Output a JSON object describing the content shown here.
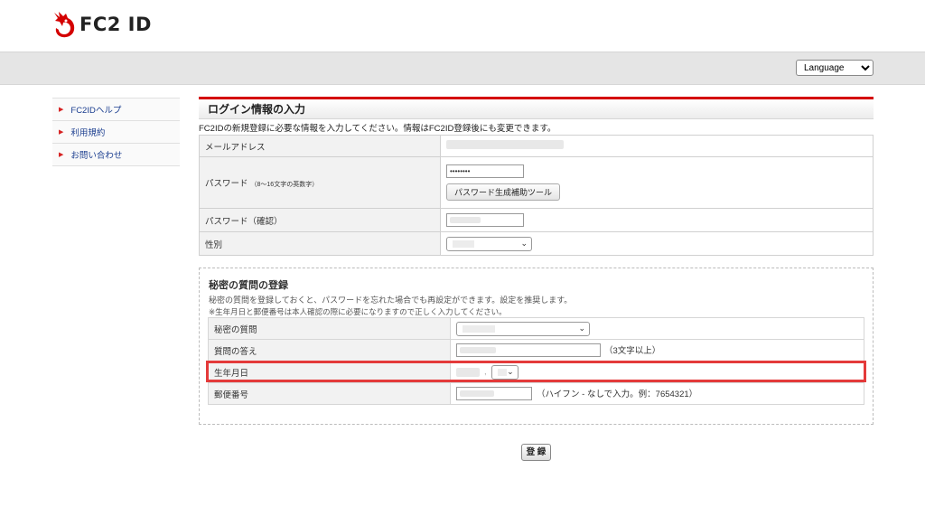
{
  "brand": {
    "name": "FC2 ID",
    "accent": "#d40000"
  },
  "topbar": {
    "language_label": "Language"
  },
  "sidebar": {
    "items": [
      {
        "label": "FC2IDヘルプ"
      },
      {
        "label": "利用規約"
      },
      {
        "label": "お問い合わせ"
      }
    ]
  },
  "login_section": {
    "title": "ログイン情報の入力",
    "intro": "FC2IDの新規登録に必要な情報を入力してください。情報はFC2ID登録後にも変更できます。",
    "email_label": "メールアドレス",
    "password_label": "パスワード",
    "password_note": "（8～16文字の英数字）",
    "password_value": "••••••••",
    "password_tool_button": "パスワード生成補助ツール",
    "password_confirm_label": "パスワード（確認）",
    "gender_label": "性別"
  },
  "secret_section": {
    "title": "秘密の質問の登録",
    "desc_line1": "秘密の質問を登録しておくと、パスワードを忘れた場合でも再設定ができます。設定を推奨します。",
    "desc_line2": "※生年月日と郵便番号は本人確認の際に必要になりますので正しく入力してください。",
    "question_label": "秘密の質問",
    "answer_label": "質問の答え",
    "answer_note": "（3文字以上）",
    "birthday_label": "生年月日",
    "postal_label": "郵便番号",
    "postal_note": "（ハイフン - なしで入力。例：7654321）"
  },
  "submit_label": "登 録"
}
